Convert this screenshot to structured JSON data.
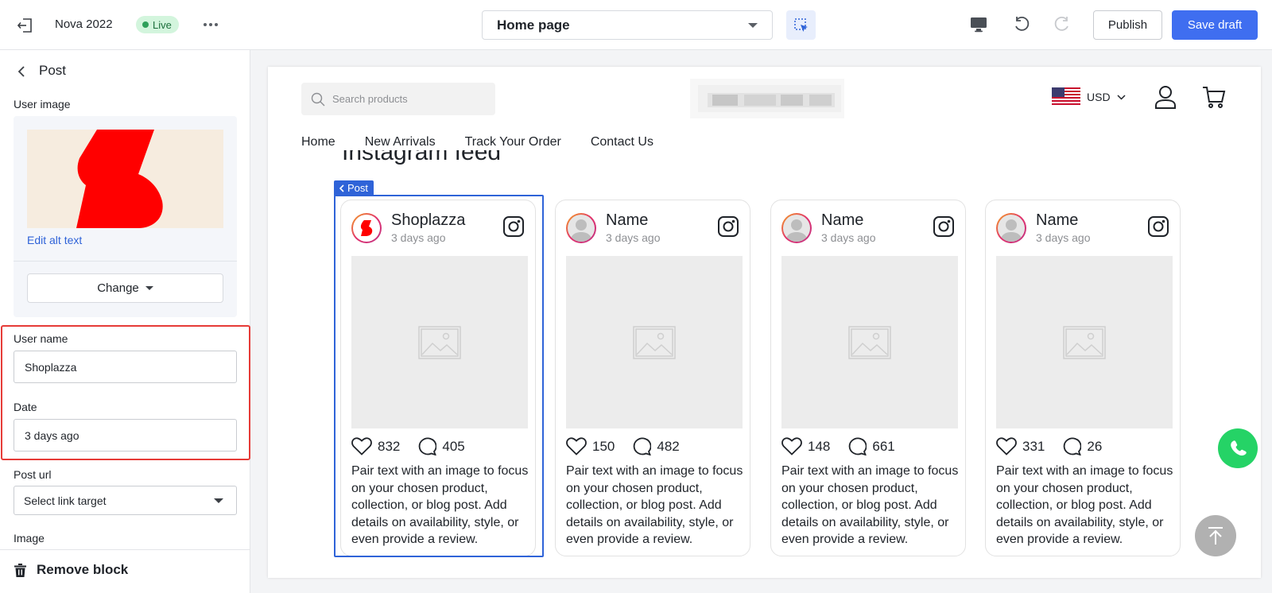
{
  "topbar": {
    "theme_name": "Nova 2022",
    "live_label": "Live",
    "page_selector": "Home page",
    "publish_label": "Publish",
    "save_label": "Save draft",
    "colors": {
      "accent": "#3f6ef0",
      "live_bg": "#d3f5dd",
      "live_dot": "#2ea05a"
    },
    "icons": [
      "exit-icon",
      "more-icon",
      "select-tool-icon",
      "desktop-icon",
      "undo-icon",
      "redo-icon"
    ]
  },
  "sidebar": {
    "title": "Post",
    "user_image_label": "User image",
    "edit_alt_label": "Edit alt text",
    "change_label": "Change",
    "username_label": "User name",
    "username_value": "Shoplazza",
    "date_label": "Date",
    "date_value": "3 days ago",
    "post_url_label": "Post url",
    "post_url_placeholder": "Select link target",
    "image_label": "Image",
    "remove_label": "Remove block",
    "highlight_color": "#e63b37"
  },
  "store": {
    "search_placeholder": "Search products",
    "currency": "USD",
    "nav": [
      "Home",
      "New Arrivals",
      "Track Your Order",
      "Contact Us"
    ],
    "section_heading": "Instagram feed",
    "selected_tag": "Post",
    "posts": [
      {
        "name": "Shoplazza",
        "date": "3 days ago",
        "likes": "832",
        "comments": "405",
        "text": "Pair text with an image to focus on your chosen product, collection, or blog post. Add details on availability, style, or even provide a review."
      },
      {
        "name": "Name",
        "date": "3 days ago",
        "likes": "150",
        "comments": "482",
        "text": "Pair text with an image to focus on your chosen product, collection, or blog post. Add details on availability, style, or even provide a review."
      },
      {
        "name": "Name",
        "date": "3 days ago",
        "likes": "148",
        "comments": "661",
        "text": "Pair text with an image to focus on your chosen product, collection, or blog post. Add details on availability, style, or even provide a review."
      },
      {
        "name": "Name",
        "date": "3 days ago",
        "likes": "331",
        "comments": "26",
        "text": "Pair text with an image to focus on your chosen product, collection, or blog post. Add details on availability, style, or even provide a review."
      }
    ]
  }
}
